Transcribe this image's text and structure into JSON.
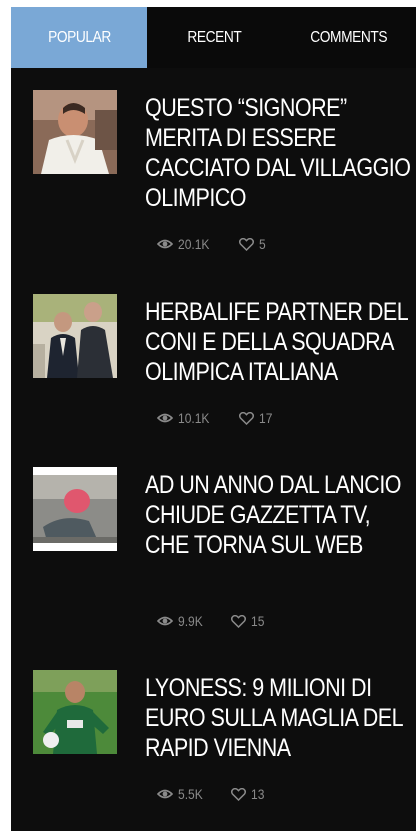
{
  "tabs": [
    {
      "label": "POPULAR",
      "active": true
    },
    {
      "label": "RECENT",
      "active": false
    },
    {
      "label": "COMMENTS",
      "active": false
    }
  ],
  "posts": [
    {
      "title": "QUESTO “SIGNORE” MERITA DI ESSERE CACCIATO DAL VILLAGGIO OLIMPICO",
      "views": "20.1K",
      "likes": "5"
    },
    {
      "title": "HERBALIFE PARTNER DEL CONI E DELLA SQUADRA OLIMPICA ITALIANA",
      "views": "10.1K",
      "likes": "17"
    },
    {
      "title": "AD UN ANNO DAL LANCIO CHIUDE GAZZETTA TV, CHE TORNA SUL WEB",
      "views": "9.9K",
      "likes": "15"
    },
    {
      "title": "LYONESS: 9 MILIONI DI EURO SULLA MAGLIA DEL RAPID VIENNA",
      "views": "5.5K",
      "likes": "13"
    }
  ],
  "colors": {
    "background": "#0d0d0d",
    "active_tab": "#7aa8d6",
    "meta_text": "#8a8a8a",
    "title_text": "#ffffff"
  },
  "icons": {
    "views": "eye-icon",
    "likes": "heart-outline-icon"
  }
}
